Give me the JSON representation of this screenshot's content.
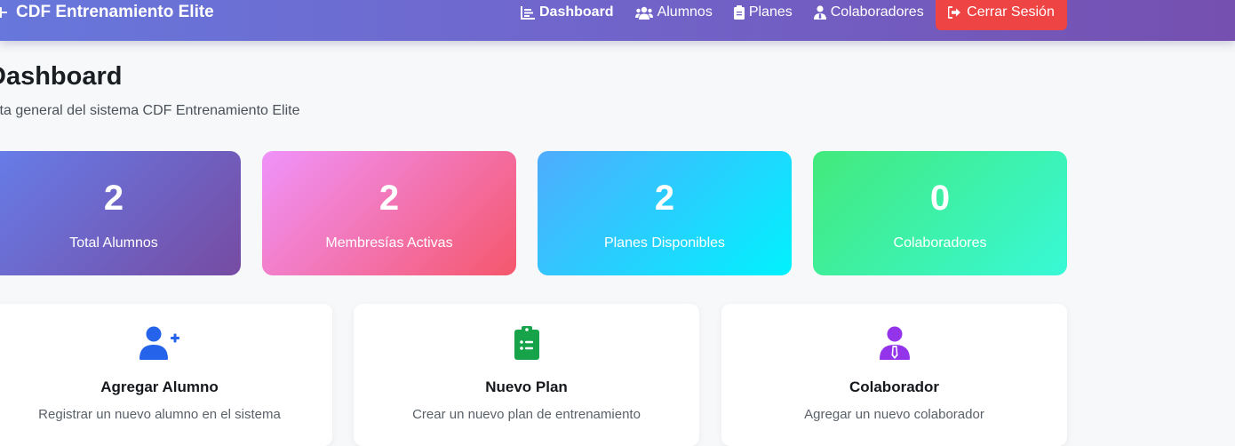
{
  "navbar": {
    "brand": "CDF Entrenamiento Elite",
    "links": [
      {
        "label": "Dashboard",
        "icon": "chart-line-icon",
        "active": true
      },
      {
        "label": "Alumnos",
        "icon": "users-icon",
        "active": false
      },
      {
        "label": "Planes",
        "icon": "clipboard-icon",
        "active": false
      },
      {
        "label": "Colaboradores",
        "icon": "user-tie-icon",
        "active": false
      }
    ],
    "logout_label": "Cerrar Sesión"
  },
  "header": {
    "title": "Dashboard",
    "subtitle": "ista general del sistema CDF Entrenamiento Elite"
  },
  "stats": [
    {
      "value": "2",
      "label": "Total Alumnos"
    },
    {
      "value": "2",
      "label": "Membresías Activas"
    },
    {
      "value": "2",
      "label": "Planes Disponibles"
    },
    {
      "value": "0",
      "label": "Colaboradores"
    }
  ],
  "actions": [
    {
      "title": "Agregar Alumno",
      "description": "Registrar un nuevo alumno en el sistema",
      "icon": "user-plus-icon",
      "color": "#2563eb"
    },
    {
      "title": "Nuevo Plan",
      "description": "Crear un nuevo plan de entrenamiento",
      "icon": "clipboard-list-icon",
      "color": "#16a34a"
    },
    {
      "title": "Colaborador",
      "description": "Agregar un nuevo colaborador",
      "icon": "user-tie-icon",
      "color": "#9333ea"
    }
  ],
  "colors": {
    "logout": "#ef4444",
    "navbar_start": "#6777db",
    "navbar_end": "#7550b0"
  }
}
